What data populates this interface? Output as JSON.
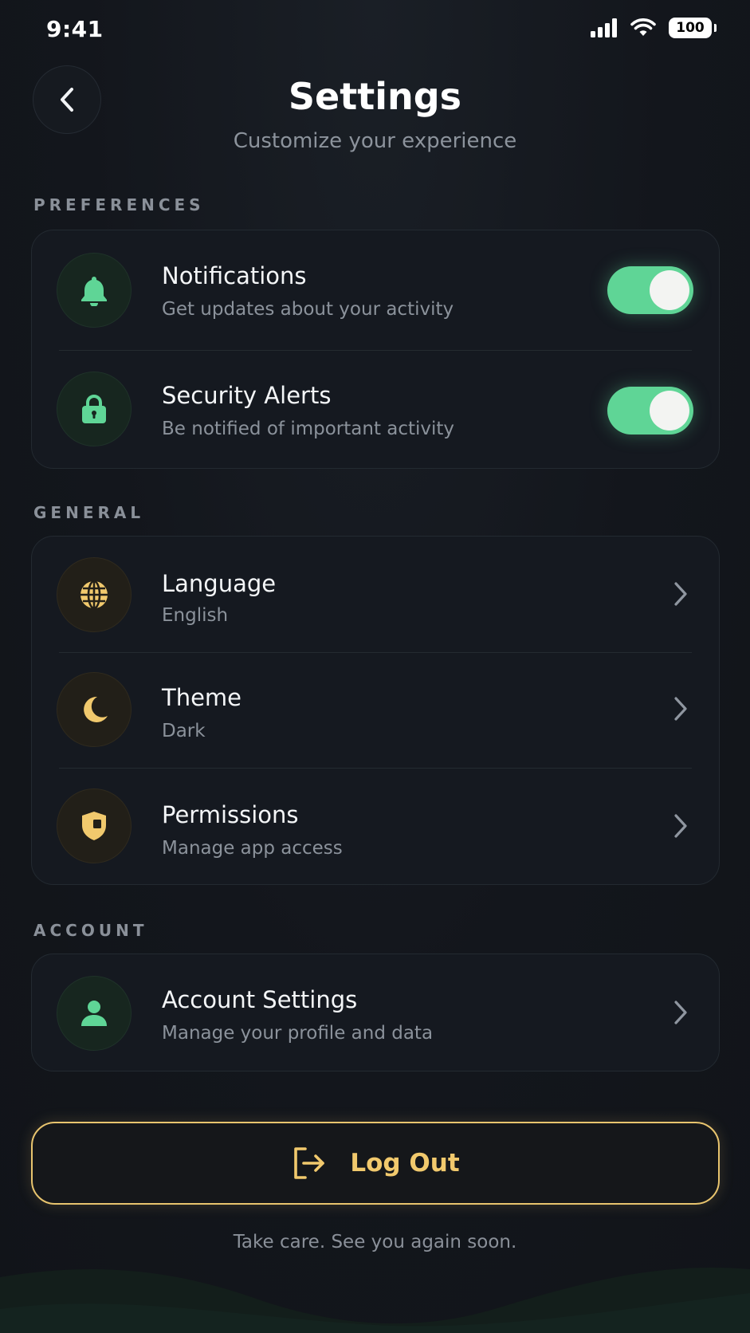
{
  "status_bar": {
    "time": "9:41",
    "battery": "100"
  },
  "header": {
    "title": "Settings",
    "subtitle": "Customize your experience"
  },
  "sections": {
    "preferences": {
      "label": "PREFERENCES",
      "items": [
        {
          "title": "Notifications",
          "subtitle": "Get updates about your activity",
          "icon": "bell-icon",
          "enabled": true
        },
        {
          "title": "Security Alerts",
          "subtitle": "Be notified of important activity",
          "icon": "lock-icon",
          "enabled": true
        }
      ]
    },
    "general": {
      "label": "GENERAL",
      "items": [
        {
          "title": "Language",
          "subtitle": "English",
          "icon": "globe-icon"
        },
        {
          "title": "Theme",
          "subtitle": "Dark",
          "icon": "moon-icon"
        },
        {
          "title": "Permissions",
          "subtitle": "Manage app access",
          "icon": "shield-icon"
        }
      ]
    },
    "account": {
      "label": "ACCOUNT",
      "items": [
        {
          "title": "Account Settings",
          "subtitle": "Manage your profile and data",
          "icon": "user-icon"
        }
      ]
    }
  },
  "logout": {
    "label": "Log Out",
    "icon": "logout-icon"
  },
  "footer": {
    "text": "Take care. See you again soon."
  },
  "colors": {
    "accent_green": "#5fd596",
    "accent_gold": "#f1c96d",
    "background": "#12151b",
    "card": "#151920"
  }
}
